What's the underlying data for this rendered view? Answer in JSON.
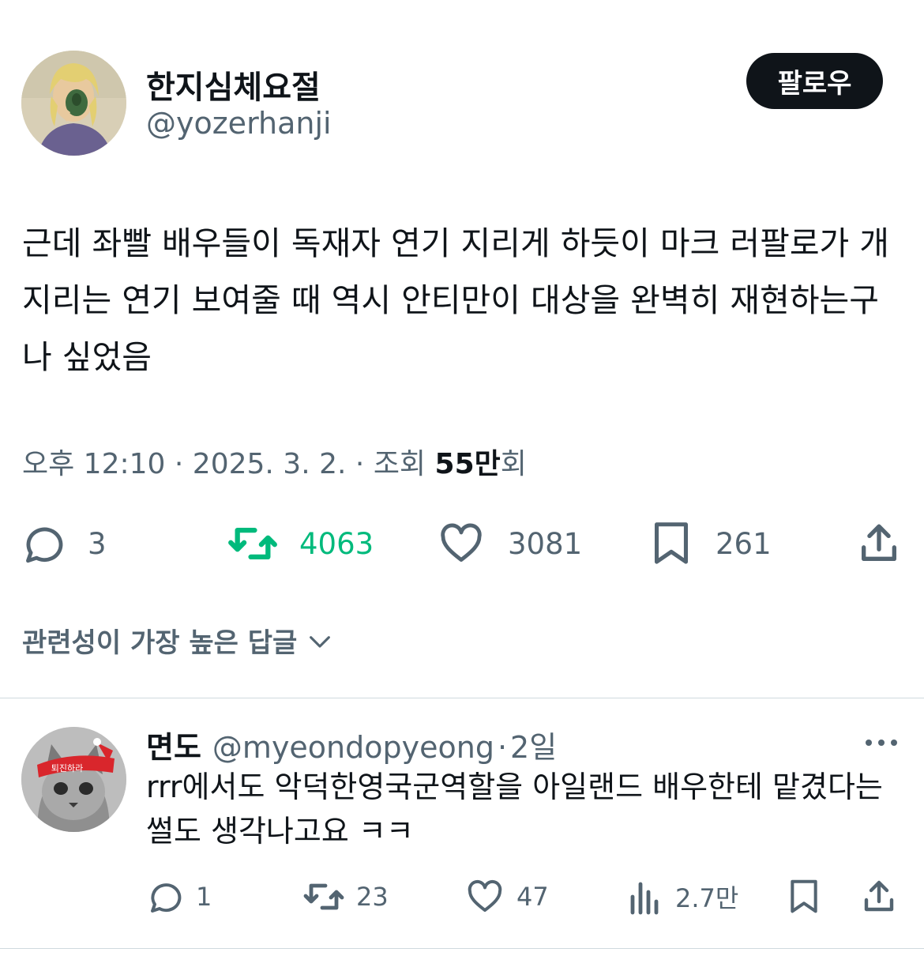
{
  "tweet": {
    "author_name": "한지심체요절",
    "author_handle": "@yozerhanji",
    "follow_label": "팔로우",
    "text": "근데 좌빨 배우들이 독재자 연기 지리게 하듯이 마크 러팔로가 개지리는 연기 보여줄 때 역시 안티만이 대상을 완벽히 재현하는구나 싶었음",
    "time": "오후 12:10",
    "date": "2025. 3. 2.",
    "views_label": "조회",
    "views_count": "55만",
    "views_suffix": "회",
    "replies": "3",
    "retweets": "4063",
    "likes": "3081",
    "bookmarks": "261",
    "retweet_color": "#00ba7c"
  },
  "sort": {
    "label": "관련성이 가장 높은 답글"
  },
  "reply": {
    "author_name": "면도",
    "author_handle": "@myeondopyeong",
    "time": "2일",
    "text": "rrr에서도 악덕한영국군역할을 아일랜드 배우한테 맡겼다는 썰도 생각나고요 ㅋㅋ",
    "replies": "1",
    "retweets": "23",
    "likes": "47",
    "views": "2.7만",
    "avatar_banner": "퇴진하라"
  },
  "colors": {
    "text": "#0f1419",
    "secondary": "#536471",
    "divider": "#cfd9de"
  },
  "icons": {
    "separator": "·"
  }
}
